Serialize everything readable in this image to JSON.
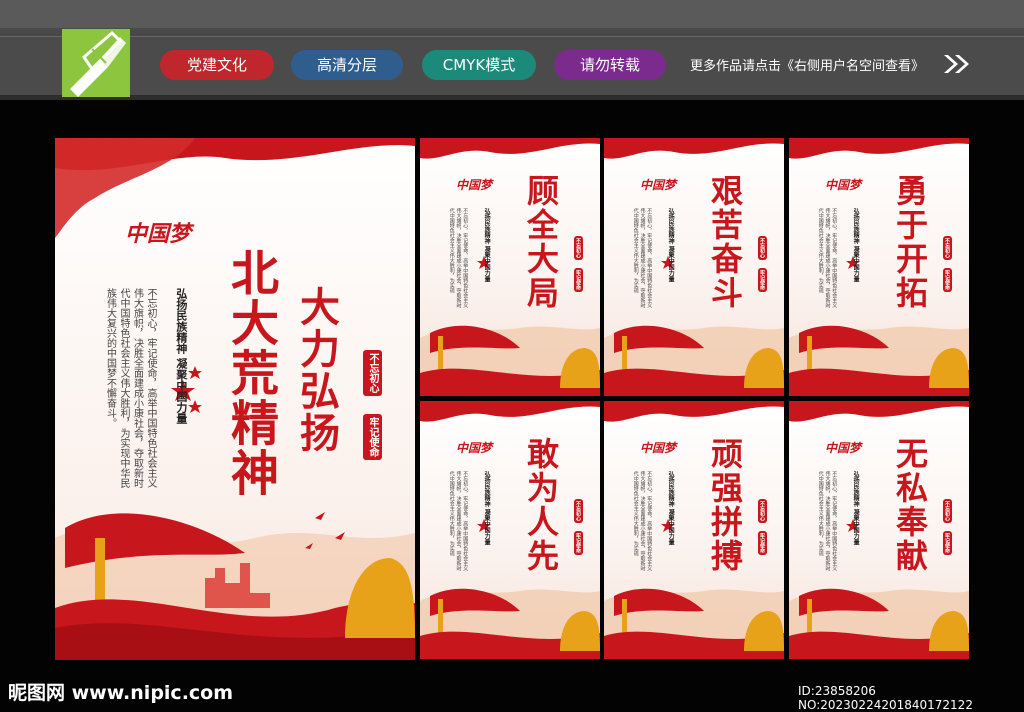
{
  "header": {
    "tags": [
      {
        "label": "党建文化",
        "color": "#c0272d"
      },
      {
        "label": "高清分层",
        "color": "#2f5e8e"
      },
      {
        "label": "CMYK模式",
        "color": "#1b8a7a"
      },
      {
        "label": "请勿转载",
        "color": "#7b2a8e"
      }
    ],
    "notice": "更多作品请点击《右侧用户名空间查看》"
  },
  "main_poster": {
    "title_main": "北大荒精神",
    "title_sub": "大力弘扬",
    "signature": "中国梦",
    "slogan": "弘扬民族精神 凝聚中国力量",
    "body": "不忘初心，牢记使命，高举中国特色社会主义伟大旗帜，决胜全面建成小康社会，夺取新时代中国特色社会主义伟大胜利，为实现中华民族伟大复兴的中国梦不懈奋斗。",
    "stamps": [
      "不忘初心",
      "牢记使命"
    ]
  },
  "small_posters": [
    {
      "title": "顾全大局"
    },
    {
      "title": "艰苦奋斗"
    },
    {
      "title": "勇于开拓"
    },
    {
      "title": "敢为人先"
    },
    {
      "title": "顽强拼搏"
    },
    {
      "title": "无私奉献"
    }
  ],
  "small_common": {
    "signature": "中国梦",
    "slogan": "弘扬民族精神 凝聚中国力量",
    "body": "不忘初心，牢记使命，高举中国特色社会主义伟大旗帜，决胜全面建成小康社会，夺取新时代中国特色社会主义伟大胜利，为实现",
    "stamps": [
      "不忘初心",
      "牢记使命"
    ]
  },
  "watermark": {
    "left": "昵图网 www.nipic.com",
    "right": "ID:23858206 NO:20230224201840172122"
  },
  "colors": {
    "accent_red": "#c8161d",
    "gold": "#e7a21a",
    "logo_green": "#8cc63f"
  }
}
